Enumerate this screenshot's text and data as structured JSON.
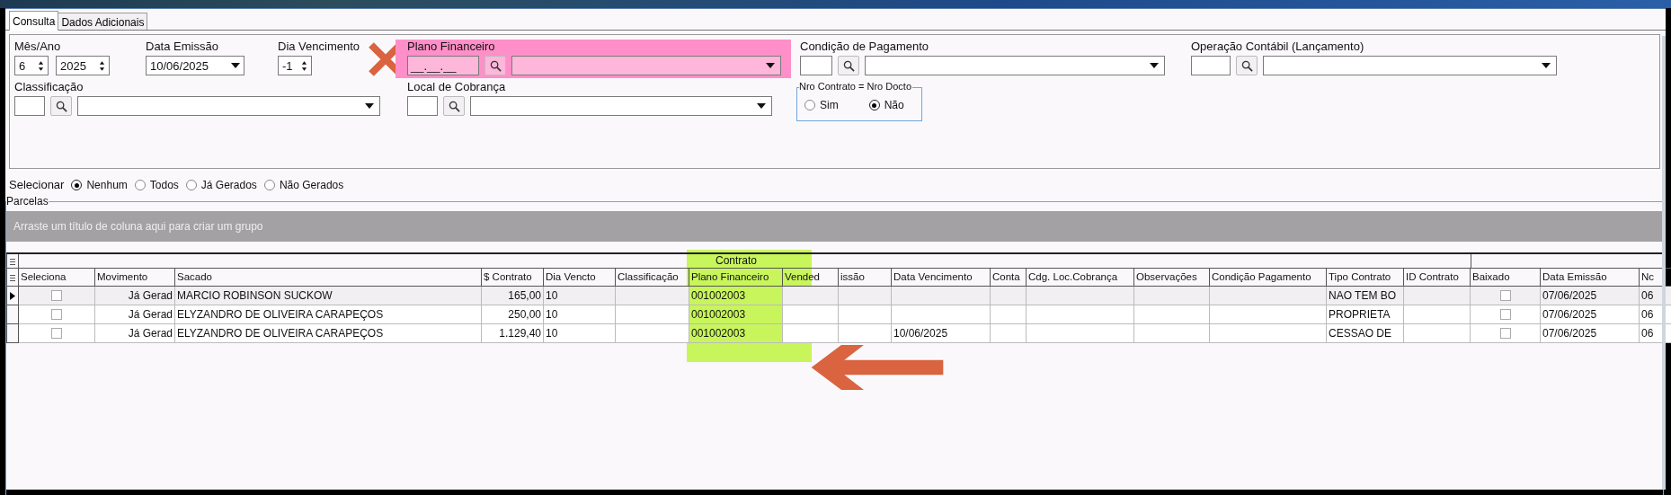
{
  "tabs": [
    {
      "label": "Consulta",
      "selected": true
    },
    {
      "label": "Dados Adicionais",
      "selected": false
    }
  ],
  "filters": {
    "mes_ano": {
      "label": "Mês/Ano",
      "month": "6",
      "year": "2025"
    },
    "data_emissao": {
      "label": "Data Emissão",
      "value": "10/06/2025"
    },
    "dia_vencimento": {
      "label": "Dia Vencimento",
      "value": "-1"
    },
    "plano_financeiro": {
      "label": "Plano Financeiro",
      "mask": "__.__.__",
      "annotations": [
        {
          "kind": "cross",
          "color": "#d9643f"
        },
        {
          "kind": "highlight",
          "color": "#ff8fc8"
        }
      ]
    },
    "condicao_pagamento": {
      "label": "Condição de Pagamento"
    },
    "operacao_contabil": {
      "label": "Operação Contábil (Lançamento)"
    },
    "classificacao": {
      "label": "Classificação"
    },
    "local_cobranca": {
      "label": "Local de Cobrança"
    },
    "nro_contrato": {
      "legend": "Nro Contrato = Nro Docto",
      "options": [
        {
          "label": "Sim",
          "selected": false
        },
        {
          "label": "Não",
          "selected": true
        }
      ]
    }
  },
  "selection": {
    "label": "Selecionar",
    "options": [
      {
        "label": "Nenhum",
        "selected": true
      },
      {
        "label": "Todos",
        "selected": false
      },
      {
        "label": "Já Gerados",
        "selected": false
      },
      {
        "label": "Não Gerados",
        "selected": false
      }
    ]
  },
  "parcelas": {
    "legend": "Parcelas",
    "group_hint": "Arraste um título de coluna aqui para criar um grupo",
    "columns": [
      {
        "label": "Seleciona",
        "kind": "check"
      },
      {
        "label": "Movimento",
        "kind": "number"
      },
      {
        "label": "Sacado",
        "kind": "text"
      },
      {
        "label": "$ Contrato",
        "kind": "number"
      },
      {
        "label": "Dia Vencto",
        "kind": "text"
      },
      {
        "label": "Classificação",
        "kind": "text"
      },
      {
        "label": "Plano Financeiro",
        "kind": "text",
        "band": "Contrato",
        "annotations": [
          {
            "kind": "highlight",
            "color": "#c8f55c"
          },
          {
            "kind": "arrow",
            "color": "#d9643f"
          }
        ]
      },
      {
        "label": "Vended",
        "kind": "text"
      },
      {
        "label": "issão",
        "kind": "text"
      },
      {
        "label": "Data Vencimento",
        "kind": "text"
      },
      {
        "label": "Conta",
        "kind": "text"
      },
      {
        "label": "Cdg. Loc.Cobrança",
        "kind": "text"
      },
      {
        "label": "Observações",
        "kind": "text"
      },
      {
        "label": "Condição Pagamento",
        "kind": "text"
      },
      {
        "label": "Tipo Contrato",
        "kind": "text"
      },
      {
        "label": "ID Contrato",
        "kind": "text"
      },
      {
        "label": "Baixado",
        "kind": "check"
      },
      {
        "label": "Data Emissão",
        "kind": "text"
      },
      {
        "label": "Nc",
        "kind": "text"
      }
    ],
    "rows": [
      {
        "current": true,
        "cells": [
          false,
          "Já Gerad",
          "MARCIO ROBINSON SUCKOW",
          "165,00",
          "10",
          null,
          "001002003",
          null,
          null,
          null,
          null,
          null,
          null,
          null,
          "NAO TEM BO",
          null,
          false,
          "07/06/2025",
          "06"
        ]
      },
      {
        "current": false,
        "cells": [
          false,
          "Já Gerad",
          "ELYZANDRO DE OLIVEIRA CARAPEÇOS",
          "250,00",
          "10",
          null,
          "001002003",
          null,
          null,
          null,
          null,
          null,
          null,
          null,
          "PROPRIETA",
          null,
          false,
          "07/06/2025",
          "06"
        ]
      },
      {
        "current": false,
        "cells": [
          false,
          "Já Gerad",
          "ELYZANDRO DE OLIVEIRA CARAPEÇOS",
          "1.129,40",
          "10",
          null,
          "001002003",
          null,
          null,
          "10/06/2025",
          null,
          null,
          null,
          null,
          "CESSAO DE",
          null,
          false,
          "07/06/2025",
          "06"
        ]
      }
    ]
  }
}
